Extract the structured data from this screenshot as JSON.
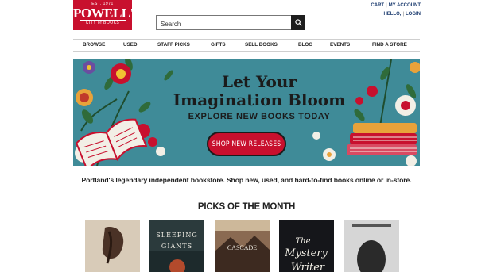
{
  "header": {
    "logo": {
      "est": "EST. 1971",
      "name": "POWELL'S",
      "sub": "CITY of BOOKS"
    },
    "search": {
      "placeholder": "Search"
    },
    "util": {
      "cart": "CART",
      "my_account": "MY ACCOUNT",
      "hello": "HELLO,",
      "login": "LOGIN"
    }
  },
  "nav": {
    "items": [
      "BROWSE",
      "USED",
      "STAFF PICKS",
      "GIFTS",
      "SELL BOOKS",
      "BLOG",
      "EVENTS",
      "FIND A STORE"
    ]
  },
  "banner": {
    "title_line1": "Let Your",
    "title_line2": "Imagination Bloom",
    "subtitle": "EXPLORE NEW BOOKS TODAY",
    "cta": "SHOP NEW RELEASES"
  },
  "tagline": "Portland's legendary independent bookstore. Shop new, used, and hard-to-find books online or in-store.",
  "picks": {
    "heading": "PICKS OF THE MONTH",
    "books": [
      {
        "title": "",
        "cover_color": "#d8cbb8"
      },
      {
        "title": "SLEEPING GIANTS",
        "cover_color": "#2b3a3c"
      },
      {
        "title": "CASCADE",
        "cover_color": "#6b4a3a"
      },
      {
        "title": "The Mystery Writer",
        "cover_color": "#15161a"
      },
      {
        "title": "",
        "cover_color": "#cfcfcf"
      }
    ]
  },
  "colors": {
    "brand_red": "#c8102e",
    "banner_teal": "#3f8b98",
    "link_navy": "#1a3a6e"
  }
}
